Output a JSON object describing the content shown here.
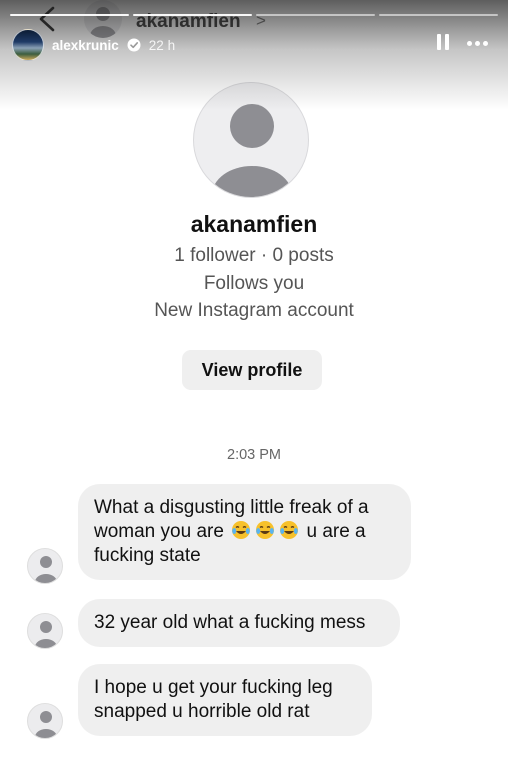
{
  "story": {
    "username": "alexkrunic",
    "time": "22 h",
    "progress_bars": 4,
    "progress_done": 2
  },
  "dm_header": {
    "username": "akanamfien",
    "chevron": ">"
  },
  "profile": {
    "name": "akanamfien",
    "stats": "1 follower · 0 posts",
    "follows": "Follows you",
    "account_note": "New Instagram account",
    "view_button": "View profile"
  },
  "timestamp": "2:03 PM",
  "messages": [
    {
      "pre": "What a disgusting little freak of a woman you are",
      "post": "u are a fucking state",
      "emoji_count": 3,
      "emoji": "face-with-tears-of-joy"
    },
    {
      "text": "32 year old what a fucking mess"
    },
    {
      "text": "I hope u get your fucking leg snapped u horrible old rat"
    }
  ],
  "colors": {
    "bubble": "#efefef",
    "meta_text": "#555555",
    "background": "#ffffff"
  }
}
